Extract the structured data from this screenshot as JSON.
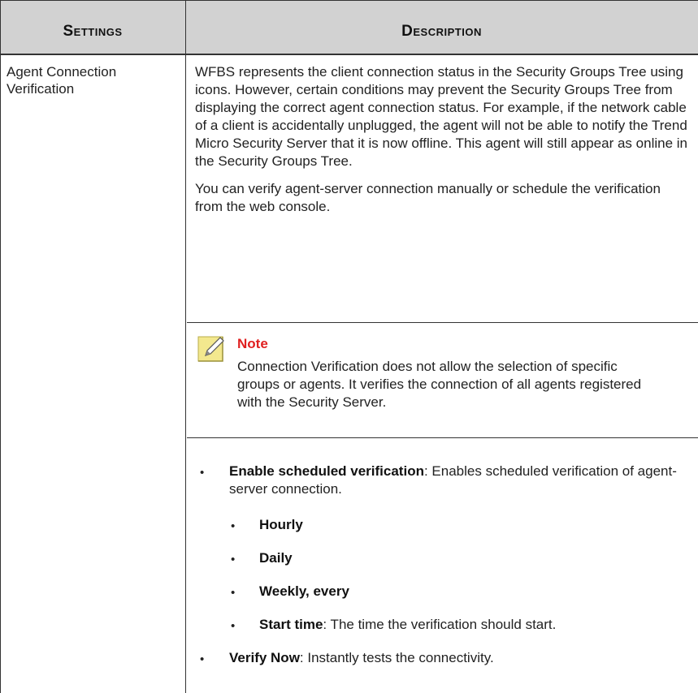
{
  "header": {
    "settings": "Settings",
    "description": "Description"
  },
  "row": {
    "setting": "Agent Connection Verification",
    "para1": "WFBS represents the client connection status in the Security Groups Tree using icons. However, certain conditions may prevent the Security Groups Tree from displaying the correct agent connection status. For example, if the network cable of a client is accidentally unplugged, the agent will not be able to notify the Trend Micro Security Server that it is now offline. This agent will still appear as online in the Security Groups Tree.",
    "para2": "You can verify agent-server connection manually or schedule the verification from the web console.",
    "note": {
      "title": "Note",
      "body": "Connection Verification does not allow the selection of specific groups or agents. It verifies the connection of all agents registered with the Security Server."
    },
    "items": [
      {
        "term": "Enable scheduled verification",
        "desc": ": Enables scheduled verification of agent-server connection.",
        "subitems": [
          {
            "term": "Hourly",
            "desc": ""
          },
          {
            "term": "Daily",
            "desc": ""
          },
          {
            "term": "Weekly, every",
            "desc": ""
          },
          {
            "term": "Start time",
            "desc": ": The time the verification should start."
          }
        ]
      },
      {
        "term": "Verify Now",
        "desc": ": Instantly tests the connectivity."
      }
    ]
  }
}
